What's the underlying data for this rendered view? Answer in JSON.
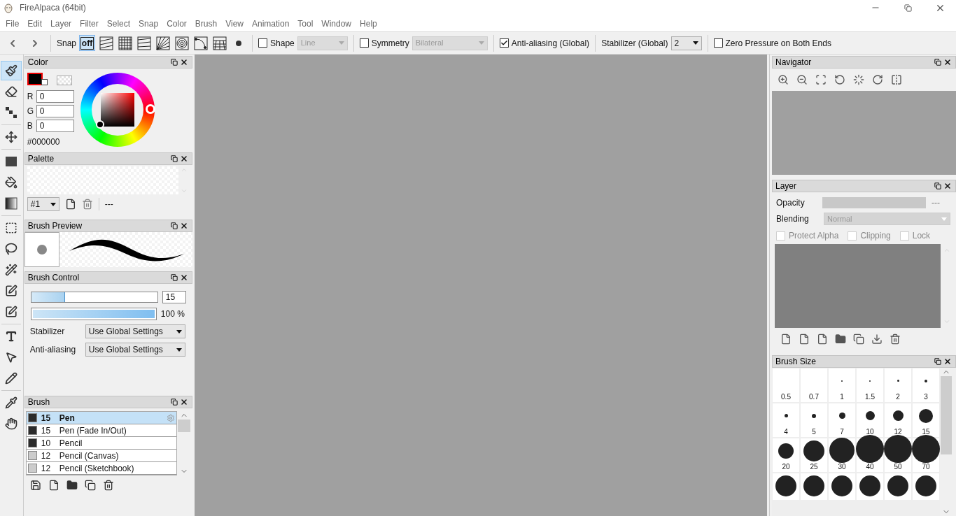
{
  "window": {
    "title": "FireAlpaca (64bit)"
  },
  "menu": [
    "File",
    "Edit",
    "Layer",
    "Filter",
    "Select",
    "Snap",
    "Color",
    "Brush",
    "View",
    "Animation",
    "Tool",
    "Window",
    "Help"
  ],
  "toolbar": {
    "snap_label": "Snap",
    "snap_modes": [
      {
        "kind": "off",
        "label": "off",
        "selected": true
      },
      {
        "kind": "parallel",
        "selected": false
      },
      {
        "kind": "grid",
        "selected": false
      },
      {
        "kind": "lines",
        "selected": false
      },
      {
        "kind": "radial",
        "selected": false
      },
      {
        "kind": "circle",
        "selected": false
      },
      {
        "kind": "curve",
        "selected": false
      },
      {
        "kind": "perspective",
        "selected": false
      },
      {
        "kind": "dot",
        "selected": false
      }
    ],
    "shape": {
      "label": "Shape",
      "checked": false,
      "value": "Line"
    },
    "symmetry": {
      "label": "Symmetry",
      "checked": false,
      "value": "Bilateral"
    },
    "antialiasing": {
      "label": "Anti-aliasing (Global)",
      "checked": true
    },
    "stabilizer": {
      "label": "Stabilizer (Global)",
      "value": "2"
    },
    "zero_pressure": {
      "label": "Zero Pressure on Both Ends",
      "checked": false
    }
  },
  "tools": [
    {
      "kind": "brush",
      "selected": true
    },
    {
      "kind": "eraser",
      "selected": false
    },
    {
      "kind": "dot",
      "selected": false
    },
    {
      "kind": "move",
      "selected": false
    },
    {
      "kind": "fill",
      "selected": false
    },
    {
      "kind": "bucket",
      "selected": false
    },
    {
      "kind": "gradient",
      "selected": false
    },
    {
      "kind": "select",
      "selected": false
    },
    {
      "kind": "lasso",
      "selected": false
    },
    {
      "kind": "wand",
      "selected": false
    },
    {
      "kind": "selpen",
      "selected": false
    },
    {
      "kind": "seleraser",
      "selected": false
    },
    {
      "kind": "text",
      "selected": false
    },
    {
      "kind": "object",
      "selected": false
    },
    {
      "kind": "divide",
      "selected": false
    },
    {
      "kind": "dropper",
      "selected": false
    },
    {
      "kind": "hand",
      "selected": false
    }
  ],
  "color_panel": {
    "title": "Color",
    "fields": [
      {
        "label": "R",
        "value": "0"
      },
      {
        "label": "G",
        "value": "0"
      },
      {
        "label": "B",
        "value": "0"
      }
    ],
    "hex": "#000000"
  },
  "palette_panel": {
    "title": "Palette",
    "selector": "#1",
    "info": "---"
  },
  "brush_preview_panel": {
    "title": "Brush Preview"
  },
  "brush_control_panel": {
    "title": "Brush Control",
    "size": {
      "level": 0.27,
      "value": "15"
    },
    "opacity": {
      "level": 1,
      "reading": "100 %"
    },
    "settings": [
      {
        "label": "Stabilizer",
        "value": "Use Global Settings"
      },
      {
        "label": "Anti-aliasing",
        "value": "Use Global Settings"
      }
    ]
  },
  "brush_panel": {
    "title": "Brush",
    "items": [
      {
        "size": "15",
        "name": "Pen",
        "selected": true,
        "color": "#2b2b2b"
      },
      {
        "size": "15",
        "name": "Pen (Fade In/Out)",
        "selected": false,
        "color": "#2b2b2b"
      },
      {
        "size": "10",
        "name": "Pencil",
        "selected": false,
        "color": "#2b2b2b"
      },
      {
        "size": "12",
        "name": "Pencil (Canvas)",
        "selected": false,
        "color": "#cccccc"
      },
      {
        "size": "12",
        "name": "Pencil (Sketchbook)",
        "selected": false,
        "color": "#cccccc"
      }
    ]
  },
  "navigator_panel": {
    "title": "Navigator"
  },
  "layer_panel": {
    "title": "Layer",
    "opacity_label": "Opacity",
    "opacity_disabled": true,
    "opacity_reading": "---",
    "blending_label": "Blending",
    "blending_value": "Normal",
    "blending_disabled": true,
    "options": [
      {
        "label": "Protect Alpha",
        "checked": false
      },
      {
        "label": "Clipping",
        "checked": false
      },
      {
        "label": "Lock",
        "checked": false
      }
    ]
  },
  "brush_size_panel": {
    "title": "Brush Size",
    "sizes": [
      "0.5",
      "0.7",
      "1",
      "1.5",
      "2",
      "3",
      "4",
      "5",
      "7",
      "10",
      "12",
      "15",
      "20",
      "25",
      "30",
      "40",
      "50",
      "70"
    ]
  }
}
